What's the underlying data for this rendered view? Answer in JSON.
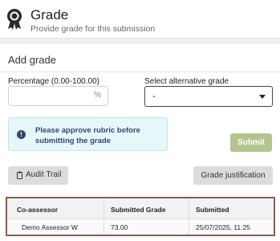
{
  "header": {
    "title": "Grade",
    "subtitle": "Provide grade for this submission",
    "icon": "award-ribbon-icon"
  },
  "form": {
    "section_title": "Add grade",
    "percentage": {
      "label": "Percentage (0.00-100.00)",
      "value": "",
      "suffix": "%"
    },
    "alternative_grade": {
      "label": "Select alternative grade",
      "selected": "-"
    },
    "alert": {
      "icon": "info-icon",
      "icon_glyph": "!",
      "text": "Please approve rubric before submitting the grade",
      "color": "#2e4a6e",
      "background": "#e7f7f9"
    },
    "submit_label": "Submit",
    "submit_color": "#b3c58e"
  },
  "actions": {
    "audit_trail_label": "Audit Trail",
    "grade_justification_label": "Grade justification"
  },
  "assessors_table": {
    "columns": [
      "Co-assessor",
      "Submitted Grade",
      "Submitted"
    ],
    "rows": [
      [
        "Demo Assessor W",
        "73.00",
        "25/07/2025, 11:25"
      ]
    ],
    "highlight_color": "#8b5b4f"
  }
}
